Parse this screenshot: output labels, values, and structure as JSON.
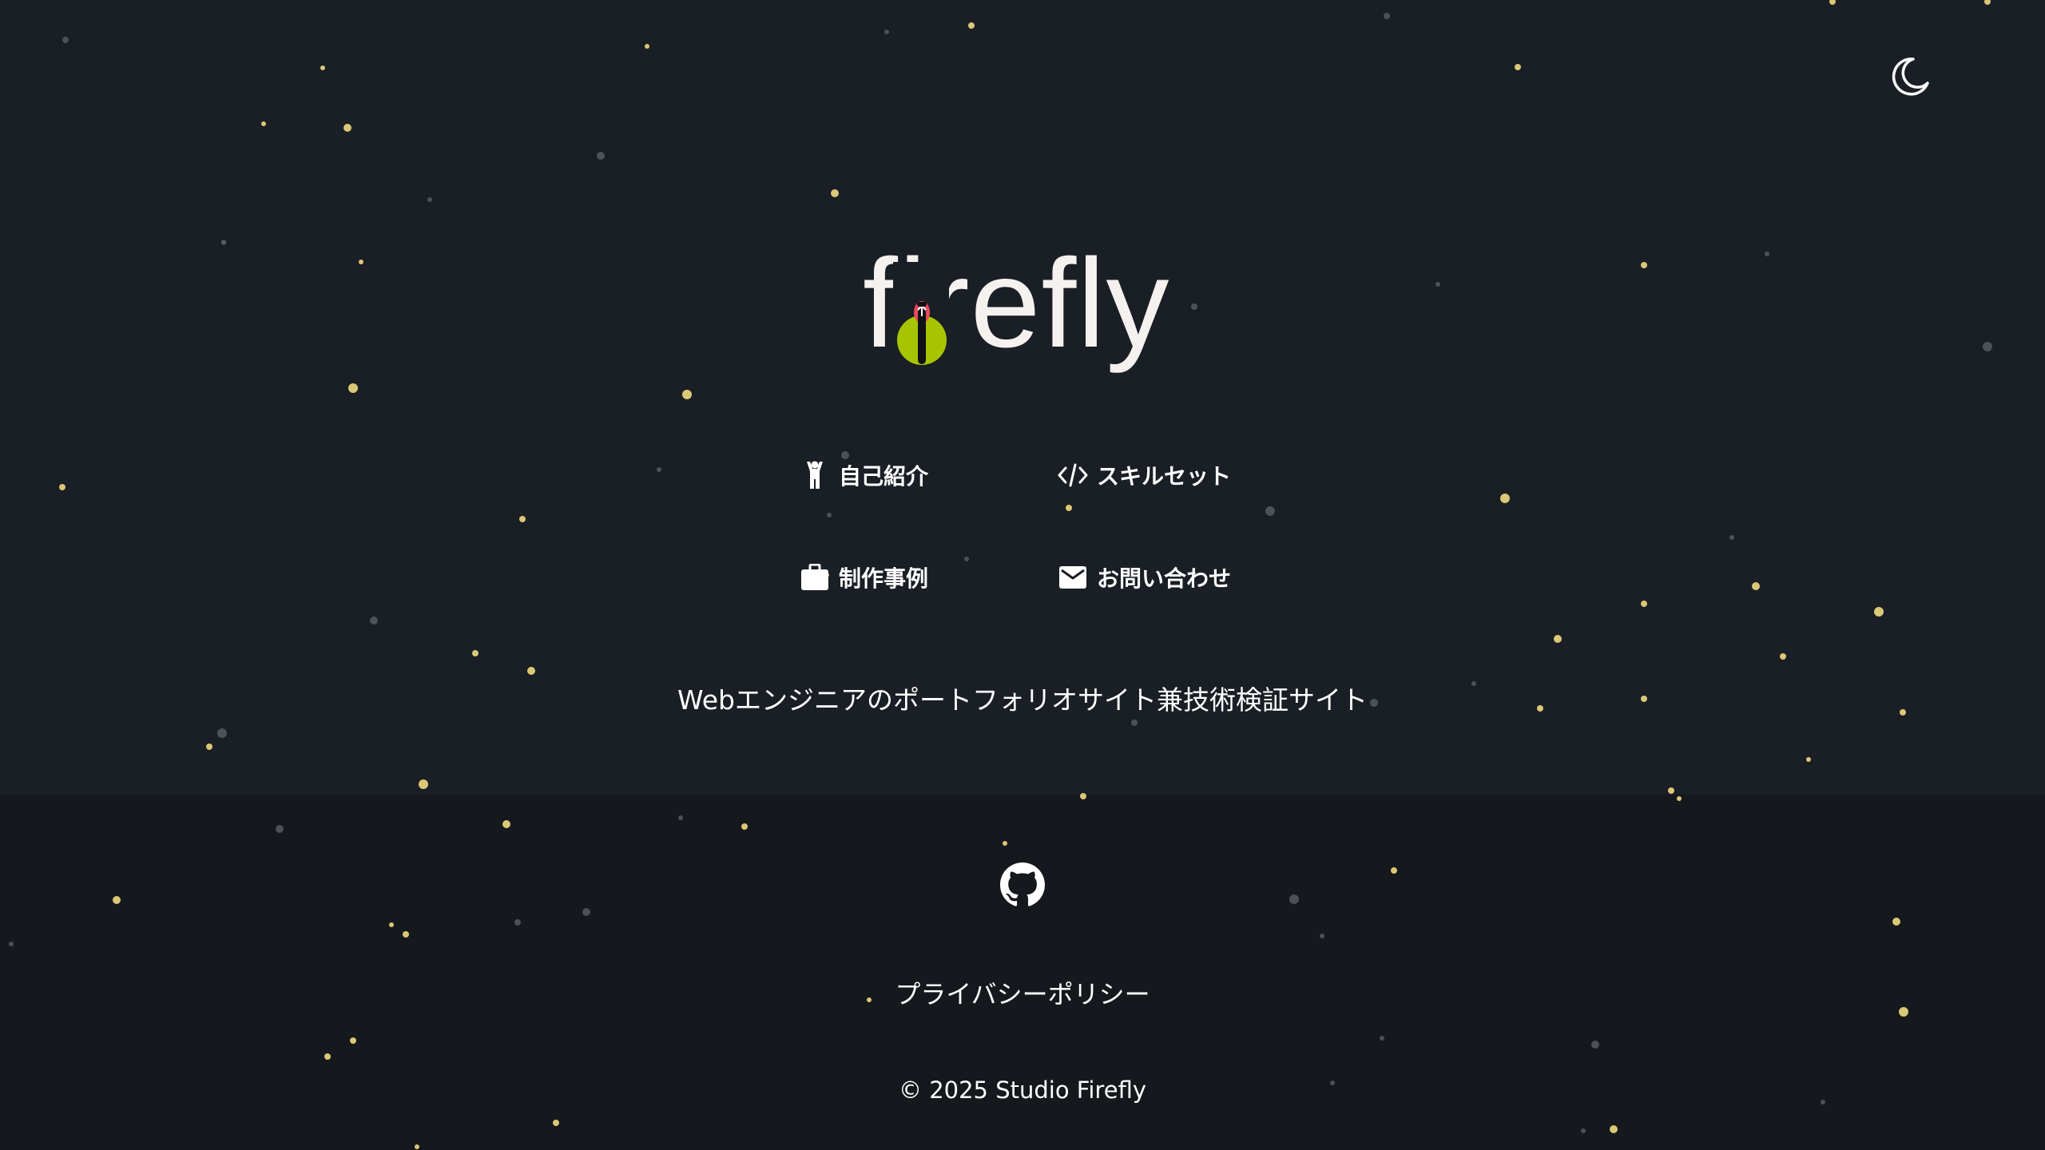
{
  "brand": {
    "logo_text": "firefly",
    "accent_color": "#a7c400",
    "light_color": "#e8495a"
  },
  "header": {
    "theme_toggle_icon": "moon-icon"
  },
  "nav": {
    "items": [
      {
        "label": "自己紹介",
        "icon": "person-icon"
      },
      {
        "label": "スキルセット",
        "icon": "code-icon"
      },
      {
        "label": "制作事例",
        "icon": "briefcase-icon"
      },
      {
        "label": "お問い合わせ",
        "icon": "mail-icon"
      }
    ]
  },
  "hero": {
    "tagline": "Webエンジニアのポートフォリオサイト兼技術検証サイト"
  },
  "footer": {
    "github_icon": "github-icon",
    "privacy_label": "プライバシーポリシー",
    "copyright": "© 2025 Studio Firefly"
  },
  "colors": {
    "background": "#1a1e25",
    "footer_background": "#15181d",
    "star_color": "#e6d27a"
  }
}
